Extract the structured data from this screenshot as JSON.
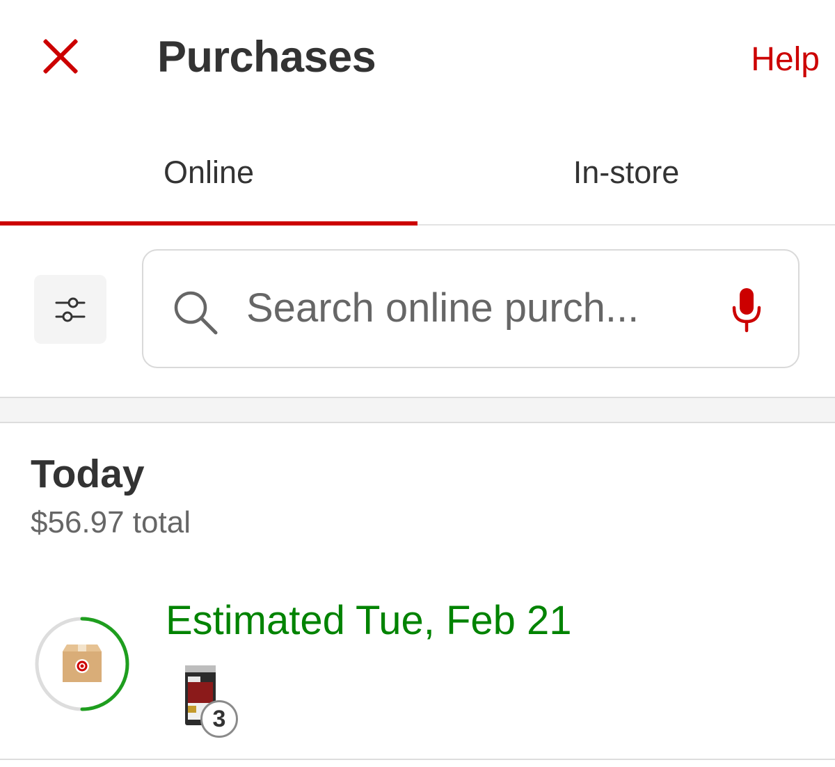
{
  "header": {
    "title": "Purchases",
    "help_label": "Help",
    "close_icon": "close-icon"
  },
  "tabs": [
    {
      "label": "Online",
      "selected": true
    },
    {
      "label": "In-store",
      "selected": false
    }
  ],
  "search": {
    "placeholder": "Search online purch...",
    "value": "",
    "icons": [
      "filter-sliders-icon",
      "search-icon",
      "microphone-icon"
    ]
  },
  "colors": {
    "accent": "#cc0000",
    "status_green": "#008300",
    "text_dark": "#333333",
    "text_muted": "#666666"
  },
  "orders": {
    "group_title": "Today",
    "group_total": "$56.97 total",
    "items": [
      {
        "status_text": "Estimated Tue, Feb 21",
        "quantity": "3",
        "status_icon": "package-box-icon",
        "progress_fraction": 0.5
      }
    ]
  }
}
